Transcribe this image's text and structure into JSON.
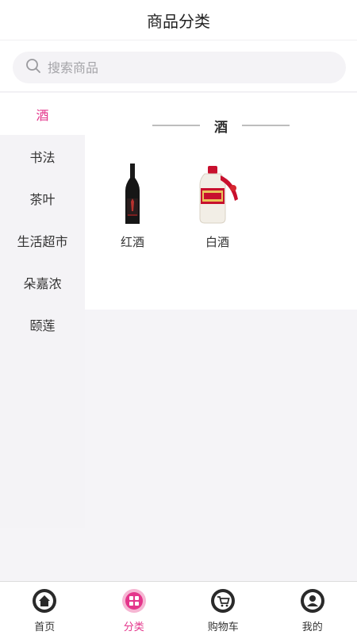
{
  "header": {
    "title": "商品分类"
  },
  "search": {
    "placeholder": "搜索商品"
  },
  "sidebar": {
    "items": [
      {
        "label": "酒",
        "active": true
      },
      {
        "label": "书法",
        "active": false
      },
      {
        "label": "茶叶",
        "active": false
      },
      {
        "label": "生活超市",
        "active": false
      },
      {
        "label": "朵嘉浓",
        "active": false
      },
      {
        "label": "颐莲",
        "active": false
      }
    ]
  },
  "content": {
    "section_title": "酒",
    "products": [
      {
        "name": "红酒",
        "icon": "red-wine-bottle"
      },
      {
        "name": "白酒",
        "icon": "baijiu-bottle"
      }
    ]
  },
  "tabbar": {
    "items": [
      {
        "label": "首页",
        "icon": "home-icon",
        "active": false
      },
      {
        "label": "分类",
        "icon": "category-icon",
        "active": true
      },
      {
        "label": "购物车",
        "icon": "cart-icon",
        "active": false
      },
      {
        "label": "我的",
        "icon": "profile-icon",
        "active": false
      }
    ]
  },
  "colors": {
    "accent": "#e4358b",
    "background": "#f5f4f7",
    "sidebar": "#f4f3f6"
  }
}
